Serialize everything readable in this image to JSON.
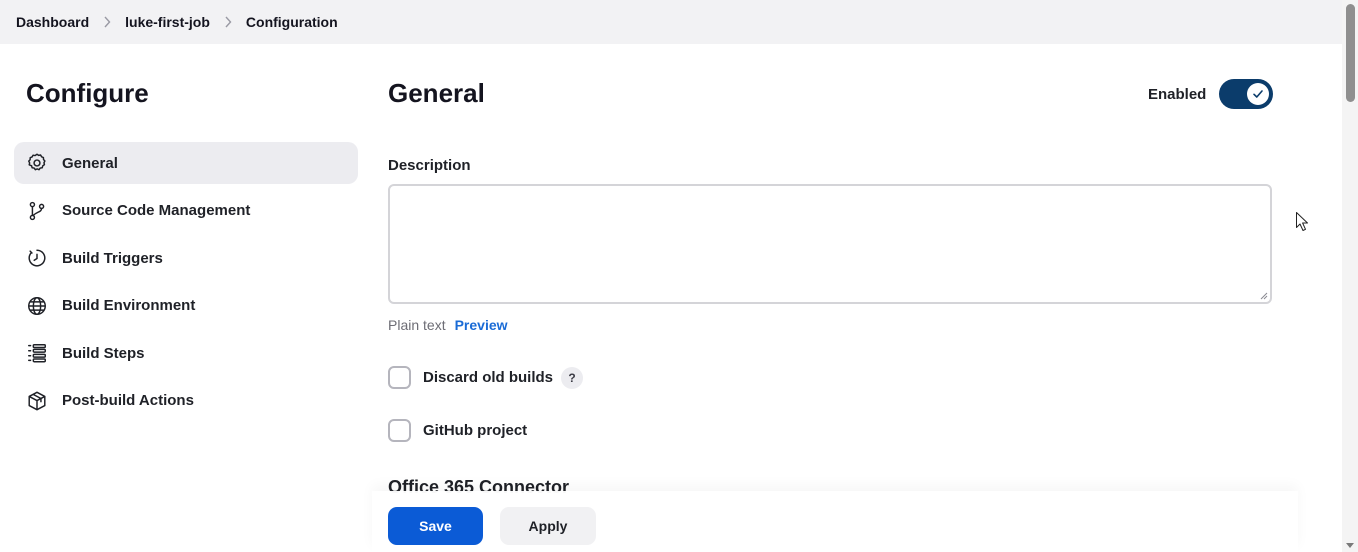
{
  "breadcrumb": {
    "items": [
      "Dashboard",
      "luke-first-job",
      "Configuration"
    ]
  },
  "sidebar": {
    "title": "Configure",
    "items": [
      {
        "label": "General",
        "icon": "gear-icon",
        "active": true
      },
      {
        "label": "Source Code Management",
        "icon": "branch-icon",
        "active": false
      },
      {
        "label": "Build Triggers",
        "icon": "timer-icon",
        "active": false
      },
      {
        "label": "Build Environment",
        "icon": "globe-icon",
        "active": false
      },
      {
        "label": "Build Steps",
        "icon": "list-icon",
        "active": false
      },
      {
        "label": "Post-build Actions",
        "icon": "package-icon",
        "active": false
      }
    ]
  },
  "main": {
    "title": "General",
    "enabled_label": "Enabled",
    "enabled": true,
    "description": {
      "label": "Description",
      "value": "",
      "plain_text": "Plain text",
      "preview": "Preview"
    },
    "options": [
      {
        "label": "Discard old builds",
        "checked": false,
        "help": "?"
      },
      {
        "label": "GitHub project",
        "checked": false
      }
    ],
    "next_section": "Office 365 Connector"
  },
  "actions": {
    "save": "Save",
    "apply": "Apply"
  },
  "colors": {
    "primary": "#0b5bd6",
    "toggle_on": "#0b3c6b",
    "link": "#1a6bd6",
    "active_nav_bg": "#ececf0"
  }
}
